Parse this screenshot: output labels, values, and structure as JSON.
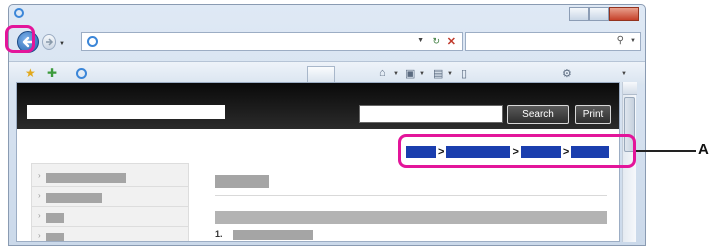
{
  "site": {
    "search_button_label": "Search",
    "print_button_label": "Print"
  },
  "content": {
    "step_number": "1."
  },
  "annotation": {
    "callout_label": "A"
  },
  "colors": {
    "highlight": "#e3159a",
    "breadcrumb_link": "#1a3eae",
    "site_header": "#111111"
  },
  "icons": {
    "back": "back-arrow-icon",
    "forward": "forward-arrow-icon",
    "refresh": "refresh-icon",
    "stop": "stop-icon",
    "search": "search-icon",
    "favorites": "favorites-star-icon",
    "add_favorite": "add-favorite-icon",
    "home": "home-icon",
    "feeds": "feeds-icon",
    "print": "print-icon",
    "page": "page-icon",
    "tools": "tools-gear-icon"
  }
}
